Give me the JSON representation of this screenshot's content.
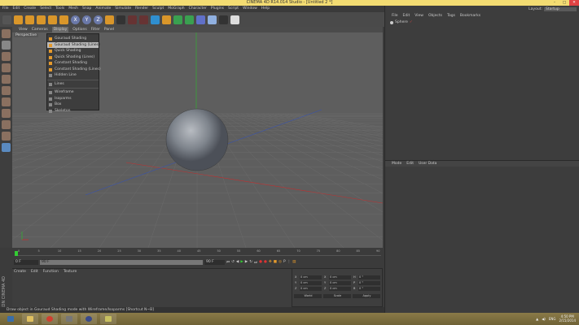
{
  "window": {
    "title": "CINEMA 4D R14.014 Studio - [Untitled 2 *]",
    "minimize": "–",
    "maximize": "□",
    "close": "✕"
  },
  "menubar": [
    "File",
    "Edit",
    "Create",
    "Select",
    "Tools",
    "Mesh",
    "Snap",
    "Animate",
    "Simulate",
    "Render",
    "Sculpt",
    "MoGraph",
    "Character",
    "Plugins",
    "Script",
    "Window",
    "Help"
  ],
  "toolbar_icons": [
    "undo-icon",
    "live-selection-icon",
    "move-icon",
    "scale-icon",
    "rotate-icon",
    "recent-tool-icon",
    "x-axis-icon",
    "y-axis-icon",
    "z-axis-icon",
    "coordinate-system-icon",
    "render-view-icon",
    "render-picture-viewer-icon",
    "edit-render-settings-icon",
    "cube-icon",
    "pen-icon",
    "subdivision-icon",
    "array-icon",
    "deformer-icon",
    "floor-icon",
    "camera-icon",
    "light-icon"
  ],
  "toolbar_axes": [
    "X",
    "Y",
    "Z"
  ],
  "viewport": {
    "menu": [
      "View",
      "Cameras",
      "Display",
      "Options",
      "Filter",
      "Panel"
    ],
    "active_menu": "Display",
    "label": "Perspective"
  },
  "display_menu": {
    "items": [
      "Gouraud Shading",
      "Gouraud Shading (Lines)",
      "Quick Shading",
      "Quick Shading (Lines)",
      "Constant Shading",
      "Constant Shading (Lines)",
      "Hidden Line",
      "Lines",
      "Wireframe",
      "Isoparms",
      "Box",
      "Skeleton"
    ],
    "highlighted": "Gouraud Shading (Lines)"
  },
  "layout": {
    "label": "Layout:",
    "value": "Startup"
  },
  "object_manager": {
    "menu": [
      "File",
      "Edit",
      "View",
      "Objects",
      "Tags",
      "Bookmarks"
    ],
    "objects": [
      "Sphere"
    ]
  },
  "attribute_manager": {
    "menu": [
      "Mode",
      "Edit",
      "User Data"
    ]
  },
  "timeline": {
    "ticks": [
      "0",
      "5",
      "10",
      "15",
      "20",
      "25",
      "30",
      "35",
      "40",
      "45",
      "50",
      "55",
      "60",
      "65",
      "70",
      "75",
      "80",
      "85",
      "90"
    ],
    "start": "0 F",
    "end": "90 F",
    "current": "0 F",
    "max": "90 F"
  },
  "material_manager": {
    "menu": [
      "Create",
      "Edit",
      "Function",
      "Texture"
    ]
  },
  "coordinates": {
    "rows": [
      [
        "X",
        "0 cm",
        "X",
        "0 cm",
        "H",
        "0 °"
      ],
      [
        "Y",
        "0 cm",
        "Y",
        "0 cm",
        "P",
        "0 °"
      ],
      [
        "Z",
        "0 cm",
        "Z",
        "0 cm",
        "B",
        "0 °"
      ]
    ],
    "mode": "World",
    "scale": "Scale",
    "apply": "Apply"
  },
  "brand": "MAXON CINEMA 4D",
  "status": "Draw object in Gouraud Shading mode with Wireframe/Isoparms [Shortcut N~B]",
  "taskbar": {
    "apps": [
      "start-icon",
      "file-explorer-icon",
      "chrome-icon",
      "settings-icon",
      "cinema4d-icon",
      "folder-icon"
    ],
    "lang": "ENG",
    "time": "4:50 PM",
    "date": "2/15/2014"
  },
  "colors": {
    "titlebar": "#f3dc72",
    "viewport": "#5e5e5e",
    "accent": "#e59a2c",
    "x_axis": "#c03030",
    "y_axis": "#30b030",
    "z_axis": "#3050c0"
  }
}
